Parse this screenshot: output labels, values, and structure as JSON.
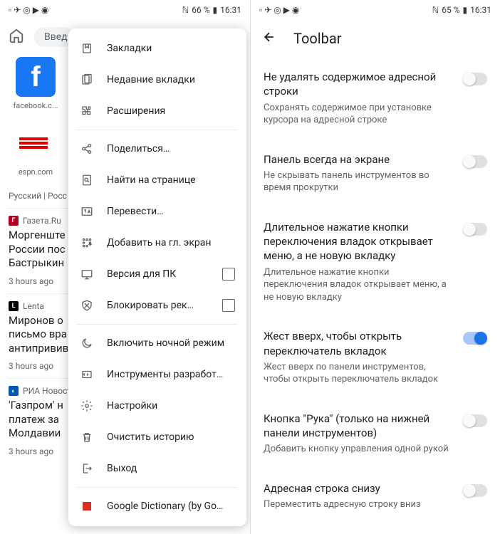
{
  "status_left": {
    "battery1": "66 %",
    "time": "16:31",
    "battery2": "65 %"
  },
  "s1": {
    "search_placeholder": "Введ",
    "tiles": [
      {
        "label": "facebook.c..."
      },
      {
        "label": "espn.com"
      }
    ],
    "lang_row": "Русский | Росс",
    "news": [
      {
        "badge": "Г",
        "badge_bg": "#b00020",
        "source": "Газета.Ru",
        "title": "Моргенште\nРоссии пос\nБастрыкин",
        "time": "3 hours ago"
      },
      {
        "badge": "L",
        "badge_bg": "#000",
        "source": "Lenta",
        "title": "Миронов о\nписьмо вра\nантипривив",
        "time": "3 hours ago"
      },
      {
        "badge": "◐",
        "badge_bg": "#0057b7",
        "source": "РИА Новост",
        "title": "'Газпром' н\nплатеж за\nМолдавии",
        "time": "3 hours ago"
      }
    ],
    "menu": [
      {
        "icon": "bookmark",
        "label": "Закладки"
      },
      {
        "icon": "recent",
        "label": "Недавние вкладки"
      },
      {
        "icon": "ext",
        "label": "Расширения"
      },
      {
        "divider": true
      },
      {
        "icon": "share",
        "label": "Поделиться…"
      },
      {
        "icon": "find",
        "label": "Найти на странице"
      },
      {
        "icon": "translate",
        "label": "Перевести…"
      },
      {
        "icon": "addhome",
        "label": "Добавить на гл. экран"
      },
      {
        "icon": "desktop",
        "label": "Версия для ПК",
        "checkbox": true
      },
      {
        "icon": "shield",
        "label": "Блокировать рек…",
        "checkbox": true
      },
      {
        "divider": true
      },
      {
        "icon": "moon",
        "label": "Включить ночной режим"
      },
      {
        "icon": "devtools",
        "label": "Инструменты разработ…"
      },
      {
        "icon": "settings",
        "label": "Настройки"
      },
      {
        "icon": "trash",
        "label": "Очистить историю"
      },
      {
        "icon": "exit",
        "label": "Выход"
      },
      {
        "divider": true
      },
      {
        "icon": "dict",
        "label": "Google Dictionary (by Go…"
      }
    ]
  },
  "s2": {
    "title": "Toolbar",
    "items": [
      {
        "title": "Не удалять содержимое адресной строки",
        "sub": "Сохранять содержимое при установке курсора на адресной строке",
        "on": false
      },
      {
        "title": "Панель всегда на экране",
        "sub": "Не скрывать панель инструментов во время прокрутки",
        "on": false
      },
      {
        "title": "Длительное нажатие кнопки переключения владок открывает меню, а не новую вкладку",
        "sub": "Длительное нажатие кнопки переключения владок открывает меню, а не новую вкладку",
        "on": false
      },
      {
        "title": "Жест вверх, чтобы открыть переключатель вкладок",
        "sub": "Жест вверх по панели инструментов, чтобы открыть переключатель вкладок",
        "on": true
      },
      {
        "title": "Кнопка \"Рука\" (только на нижней панели инструментов)",
        "sub": "Добавить кнопку управления одной рукой",
        "on": false
      },
      {
        "title": "Адресная строка снизу",
        "sub": "Переместить адресную строку вниз",
        "on": false
      }
    ]
  }
}
